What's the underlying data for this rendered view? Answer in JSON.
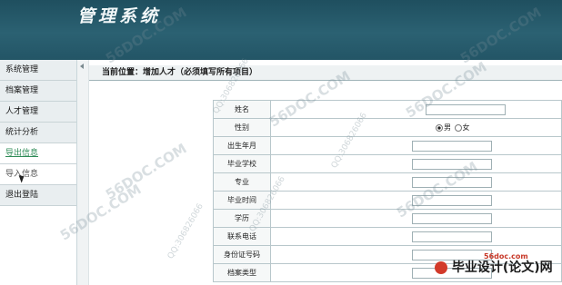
{
  "header": {
    "title": "管理系统"
  },
  "sidebar": {
    "items": [
      {
        "label": "系统管理"
      },
      {
        "label": "档案管理"
      },
      {
        "label": "人才管理"
      },
      {
        "label": "统计分析"
      },
      {
        "label": "导出信息"
      },
      {
        "label": "导入信息"
      },
      {
        "label": "退出登陆"
      }
    ]
  },
  "breadcrumb": {
    "text": "当前位置：增加人才（必须填写所有项目）"
  },
  "form": {
    "fields": [
      {
        "label": "姓名"
      },
      {
        "label": "性别"
      },
      {
        "label": "出生年月"
      },
      {
        "label": "毕业学校"
      },
      {
        "label": "专业"
      },
      {
        "label": "毕业时间"
      },
      {
        "label": "学历"
      },
      {
        "label": "联系电话"
      },
      {
        "label": "身份证号码"
      },
      {
        "label": "档案类型"
      }
    ],
    "gender_options": [
      "男",
      "女"
    ],
    "gender_selected": "男"
  },
  "watermarks": {
    "site": "56DOC.COM",
    "qq": "QQ:306826066"
  },
  "logo": {
    "text": "毕业设计(论文)网",
    "sub": "56doc.com"
  }
}
